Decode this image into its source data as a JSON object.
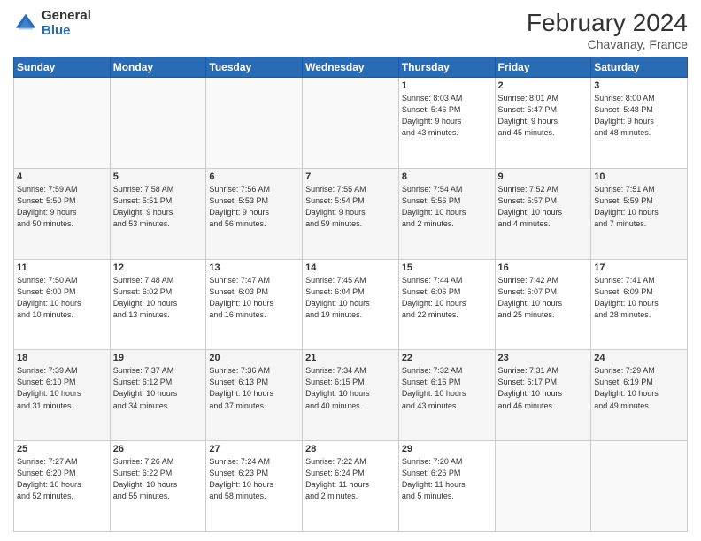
{
  "logo": {
    "general": "General",
    "blue": "Blue"
  },
  "title": "February 2024",
  "location": "Chavanay, France",
  "days_header": [
    "Sunday",
    "Monday",
    "Tuesday",
    "Wednesday",
    "Thursday",
    "Friday",
    "Saturday"
  ],
  "weeks": [
    [
      {
        "day": "",
        "info": ""
      },
      {
        "day": "",
        "info": ""
      },
      {
        "day": "",
        "info": ""
      },
      {
        "day": "",
        "info": ""
      },
      {
        "day": "1",
        "info": "Sunrise: 8:03 AM\nSunset: 5:46 PM\nDaylight: 9 hours\nand 43 minutes."
      },
      {
        "day": "2",
        "info": "Sunrise: 8:01 AM\nSunset: 5:47 PM\nDaylight: 9 hours\nand 45 minutes."
      },
      {
        "day": "3",
        "info": "Sunrise: 8:00 AM\nSunset: 5:48 PM\nDaylight: 9 hours\nand 48 minutes."
      }
    ],
    [
      {
        "day": "4",
        "info": "Sunrise: 7:59 AM\nSunset: 5:50 PM\nDaylight: 9 hours\nand 50 minutes."
      },
      {
        "day": "5",
        "info": "Sunrise: 7:58 AM\nSunset: 5:51 PM\nDaylight: 9 hours\nand 53 minutes."
      },
      {
        "day": "6",
        "info": "Sunrise: 7:56 AM\nSunset: 5:53 PM\nDaylight: 9 hours\nand 56 minutes."
      },
      {
        "day": "7",
        "info": "Sunrise: 7:55 AM\nSunset: 5:54 PM\nDaylight: 9 hours\nand 59 minutes."
      },
      {
        "day": "8",
        "info": "Sunrise: 7:54 AM\nSunset: 5:56 PM\nDaylight: 10 hours\nand 2 minutes."
      },
      {
        "day": "9",
        "info": "Sunrise: 7:52 AM\nSunset: 5:57 PM\nDaylight: 10 hours\nand 4 minutes."
      },
      {
        "day": "10",
        "info": "Sunrise: 7:51 AM\nSunset: 5:59 PM\nDaylight: 10 hours\nand 7 minutes."
      }
    ],
    [
      {
        "day": "11",
        "info": "Sunrise: 7:50 AM\nSunset: 6:00 PM\nDaylight: 10 hours\nand 10 minutes."
      },
      {
        "day": "12",
        "info": "Sunrise: 7:48 AM\nSunset: 6:02 PM\nDaylight: 10 hours\nand 13 minutes."
      },
      {
        "day": "13",
        "info": "Sunrise: 7:47 AM\nSunset: 6:03 PM\nDaylight: 10 hours\nand 16 minutes."
      },
      {
        "day": "14",
        "info": "Sunrise: 7:45 AM\nSunset: 6:04 PM\nDaylight: 10 hours\nand 19 minutes."
      },
      {
        "day": "15",
        "info": "Sunrise: 7:44 AM\nSunset: 6:06 PM\nDaylight: 10 hours\nand 22 minutes."
      },
      {
        "day": "16",
        "info": "Sunrise: 7:42 AM\nSunset: 6:07 PM\nDaylight: 10 hours\nand 25 minutes."
      },
      {
        "day": "17",
        "info": "Sunrise: 7:41 AM\nSunset: 6:09 PM\nDaylight: 10 hours\nand 28 minutes."
      }
    ],
    [
      {
        "day": "18",
        "info": "Sunrise: 7:39 AM\nSunset: 6:10 PM\nDaylight: 10 hours\nand 31 minutes."
      },
      {
        "day": "19",
        "info": "Sunrise: 7:37 AM\nSunset: 6:12 PM\nDaylight: 10 hours\nand 34 minutes."
      },
      {
        "day": "20",
        "info": "Sunrise: 7:36 AM\nSunset: 6:13 PM\nDaylight: 10 hours\nand 37 minutes."
      },
      {
        "day": "21",
        "info": "Sunrise: 7:34 AM\nSunset: 6:15 PM\nDaylight: 10 hours\nand 40 minutes."
      },
      {
        "day": "22",
        "info": "Sunrise: 7:32 AM\nSunset: 6:16 PM\nDaylight: 10 hours\nand 43 minutes."
      },
      {
        "day": "23",
        "info": "Sunrise: 7:31 AM\nSunset: 6:17 PM\nDaylight: 10 hours\nand 46 minutes."
      },
      {
        "day": "24",
        "info": "Sunrise: 7:29 AM\nSunset: 6:19 PM\nDaylight: 10 hours\nand 49 minutes."
      }
    ],
    [
      {
        "day": "25",
        "info": "Sunrise: 7:27 AM\nSunset: 6:20 PM\nDaylight: 10 hours\nand 52 minutes."
      },
      {
        "day": "26",
        "info": "Sunrise: 7:26 AM\nSunset: 6:22 PM\nDaylight: 10 hours\nand 55 minutes."
      },
      {
        "day": "27",
        "info": "Sunrise: 7:24 AM\nSunset: 6:23 PM\nDaylight: 10 hours\nand 58 minutes."
      },
      {
        "day": "28",
        "info": "Sunrise: 7:22 AM\nSunset: 6:24 PM\nDaylight: 11 hours\nand 2 minutes."
      },
      {
        "day": "29",
        "info": "Sunrise: 7:20 AM\nSunset: 6:26 PM\nDaylight: 11 hours\nand 5 minutes."
      },
      {
        "day": "",
        "info": ""
      },
      {
        "day": "",
        "info": ""
      }
    ]
  ]
}
